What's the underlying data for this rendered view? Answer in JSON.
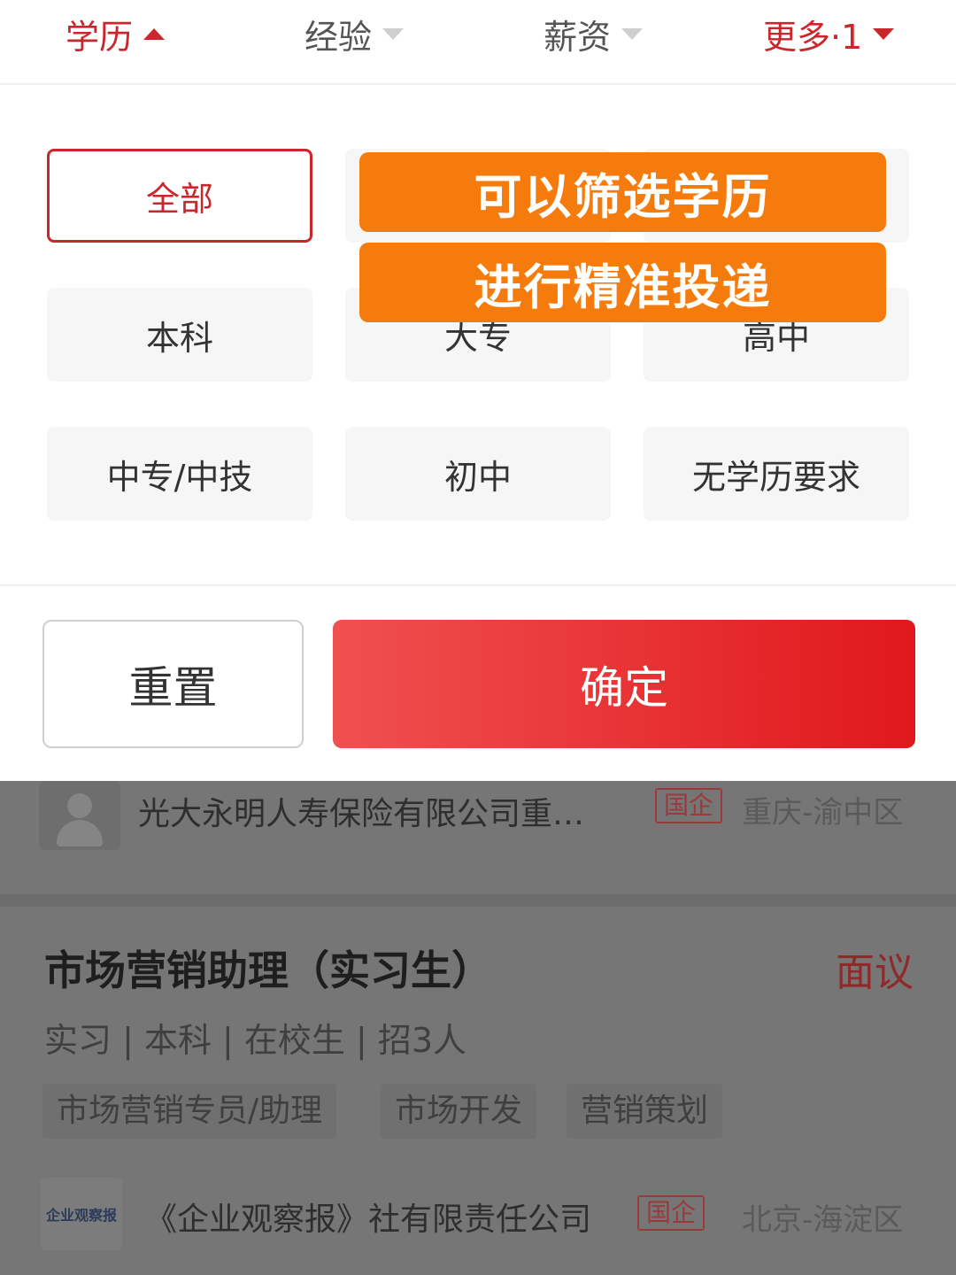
{
  "filter_tabs": [
    {
      "label": "学历"
    },
    {
      "label": "经验"
    },
    {
      "label": "薪资"
    },
    {
      "label": "更多·1"
    }
  ],
  "options": [
    "全部",
    "",
    "",
    "本科",
    "大专",
    "高中",
    "中专/中技",
    "初中",
    "无学历要求"
  ],
  "captions": [
    "可以筛选学历",
    "进行精准投递"
  ],
  "buttons": {
    "reset": "重置",
    "confirm": "确定"
  },
  "list": {
    "company1": {
      "name": "光大永明人寿保险有限公司重…",
      "badge": "国企",
      "location": "重庆-渝中区"
    },
    "job": {
      "title": "市场营销助理（实习生）",
      "salary": "面议",
      "meta": "实习 | 本科 | 在校生 | 招3人",
      "tags": [
        "市场营销专员/助理",
        "市场开发",
        "营销策划"
      ]
    },
    "company2": {
      "logo_text": "企业观察报",
      "name": "《企业观察报》社有限责任公司",
      "badge": "国企",
      "location": "北京-海淀区"
    }
  },
  "colors": {
    "accent": "#c8282c",
    "caption_bg": "#f57c0c",
    "confirm_bg": "#e0181c"
  }
}
